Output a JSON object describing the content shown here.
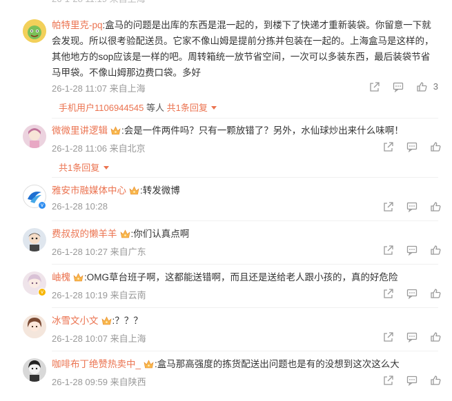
{
  "comments": [
    {
      "username": "帕特里克-pq",
      "text": ":盒马的问题是出库的东西是混一起的，到楼下了快递才重新装袋。你留意一下就会发现。所以很考验配送员。它家不像山姆是提前分拣并包装在一起的。上海盒马是这样的，其他地方的sop应该是一样的吧。周转箱统一放节省空间，一次可以多装东西，最后装袋节省马甲袋。不像山姆那边费口袋。多好",
      "time": "26-1-28 11:07 来自上海",
      "likes": "3",
      "reply_user": "手机用户1106944545",
      "reply_suffix": "等人",
      "reply_count": "共1条回复",
      "crown": false
    },
    {
      "username": "微微里讲逻辑",
      "text": ":会是一件两件吗？只有一颗放错了？另外，水仙球炒出来什么味啊！",
      "time": "26-1-28 11:06 来自北京",
      "likes": "",
      "reply_count": "共1条回复",
      "crown": true
    },
    {
      "username": "雅安市融媒体中心",
      "text": ":转发微博",
      "time": "26-1-28 10:28",
      "likes": "",
      "crown": true
    },
    {
      "username": "费叔叔的懒羊羊",
      "text": ":你们认真点啊",
      "time": "26-1-28 10:27 来自广东",
      "likes": "",
      "crown": true
    },
    {
      "username": "岫槐",
      "text": ":OMG草台班子啊，这都能送错啊，而且还是送给老人跟小孩的，真的好危险",
      "time": "26-1-28 10:19 来自云南",
      "likes": "",
      "crown": true
    },
    {
      "username": "冰雪文小文",
      "text": ":？？？",
      "time": "26-1-28 10:07 来自上海",
      "likes": "",
      "crown": true
    },
    {
      "username": "咖啡布丁绝赞热卖中_",
      "text": ":盒马那高强度的拣货配送出问题也是有的没想到这次这么大",
      "time": "26-1-28 09:59 来自陕西",
      "likes": "",
      "crown": true
    }
  ],
  "colors": {
    "username": "#eb7350",
    "meta": "#999999",
    "verified": "#2f8df0"
  },
  "icons": [
    "share-icon",
    "comment-icon",
    "like-icon",
    "crown-icon",
    "chevron-down-icon",
    "verified-icon"
  ]
}
